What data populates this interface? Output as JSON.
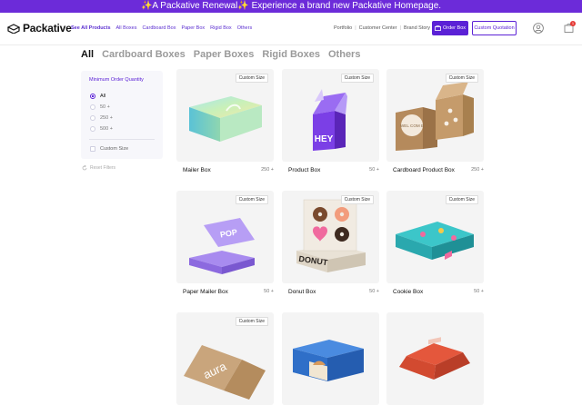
{
  "announcement": "✨A Packative Renewal✨ Experience a brand new Packative Homepage.",
  "brand": {
    "name": "Packative",
    "logo_icon": "packative-logo-icon"
  },
  "nav": {
    "items": [
      "See All Products",
      "All Boxes",
      "Cardboard Box",
      "Paper Box",
      "Rigid Box",
      "Others"
    ],
    "utility": [
      "Portfolio",
      "Customer Center",
      "Brand Story"
    ],
    "order_label": "Order Box",
    "quote_label": "Custom Quotation",
    "cart_count": "1",
    "accent_color": "#5b21d6",
    "announce_color": "#6c2bd9"
  },
  "category_tabs": [
    "All",
    "Cardboard Boxes",
    "Paper Boxes",
    "Rigid Boxes",
    "Others"
  ],
  "filter": {
    "title": "Minimum Order Quantity",
    "options": [
      "All",
      "50 +",
      "250 +",
      "500 +"
    ],
    "selected": "All",
    "custom_size_label": "Custom Size",
    "reset_label": "Reset Filters"
  },
  "products": [
    {
      "name": "Mailer Box",
      "moq": "250 +",
      "badge": "Custom Size"
    },
    {
      "name": "Product Box",
      "moq": "50 +",
      "badge": "Custom Size"
    },
    {
      "name": "Cardboard Product Box",
      "moq": "250 +",
      "badge": "Custom Size"
    },
    {
      "name": "Paper Mailer Box",
      "moq": "50 +",
      "badge": "Custom Size"
    },
    {
      "name": "Donut Box",
      "moq": "50 +",
      "badge": "Custom Size"
    },
    {
      "name": "Cookie Box",
      "moq": "50 +",
      "badge": "Custom Size"
    },
    {
      "name": "",
      "moq": "",
      "badge": "Custom Size"
    },
    {
      "name": "",
      "moq": "",
      "badge": ""
    },
    {
      "name": "",
      "moq": "",
      "badge": ""
    }
  ],
  "artwork": {
    "product_box": "HEY",
    "donut_box": "DONUT",
    "cardboard_seal": "WEL COM E",
    "paper_mailer": "POP",
    "row3_box": "aura"
  }
}
